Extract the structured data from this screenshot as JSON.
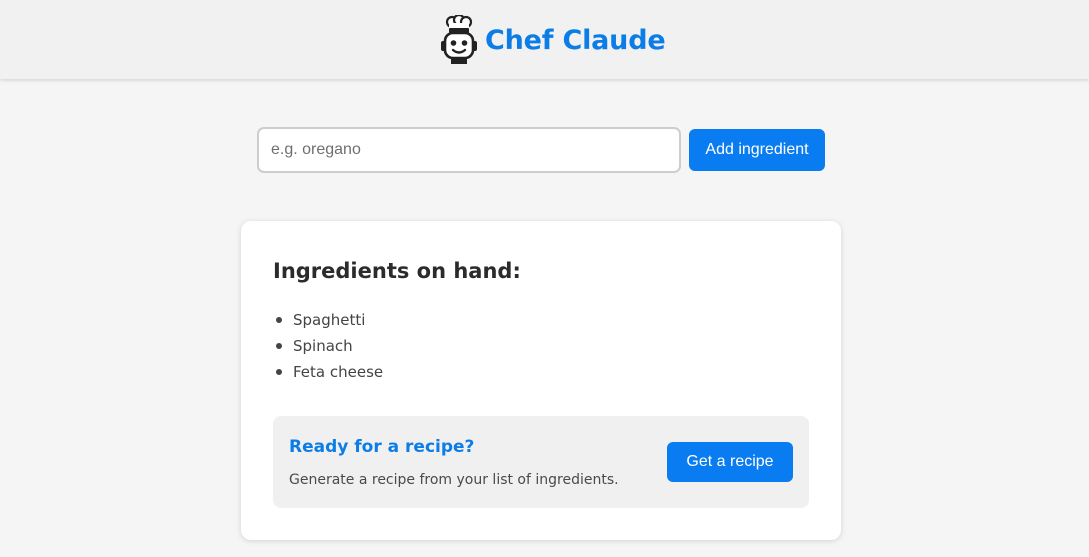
{
  "header": {
    "title": "Chef Claude",
    "logo_icon": "chef-face-icon",
    "title_color": "#0c7de6"
  },
  "form": {
    "input_placeholder": "e.g. oregano",
    "input_value": "",
    "add_button_label": "Add ingredient"
  },
  "ingredients": {
    "heading": "Ingredients on hand:",
    "items": [
      {
        "label": "Spaghetti"
      },
      {
        "label": "Spinach"
      },
      {
        "label": "Feta cheese"
      }
    ]
  },
  "recipe_prompt": {
    "heading": "Ready for a recipe?",
    "description": "Generate a recipe from your list of ingredients.",
    "button_label": "Get a recipe"
  },
  "colors": {
    "accent": "#0a7cf2",
    "page_background": "#f5f5f5",
    "card_background": "#ffffff"
  }
}
